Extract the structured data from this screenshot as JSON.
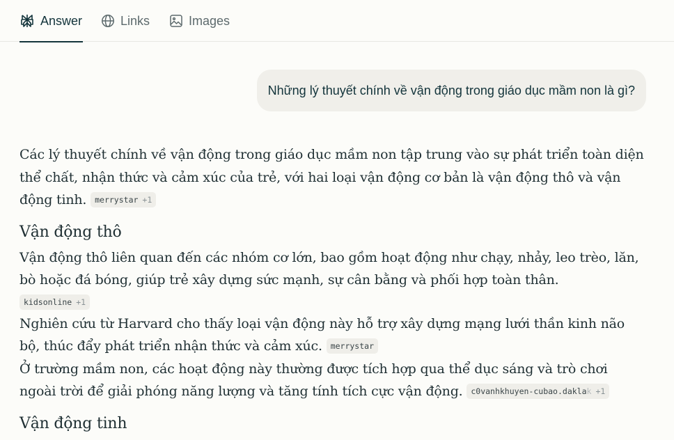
{
  "tabs": [
    {
      "label": "Answer",
      "icon": "perplexity-logo-icon",
      "active": true
    },
    {
      "label": "Links",
      "icon": "globe-icon",
      "active": false
    },
    {
      "label": "Images",
      "icon": "image-icon",
      "active": false
    }
  ],
  "query": "Những lý thuyết chính về vận động trong giáo dục mầm non là gì?",
  "answer": {
    "intro": {
      "text": "Các lý thuyết chính về vận động trong giáo dục mầm non tập trung vào sự phát triển toàn diện thể chất, nhận thức và cảm xúc của trẻ, với hai loại vận động cơ bản là vận động thô và vận động tinh. ",
      "citation": {
        "source": "merrystar",
        "more": "+1"
      }
    },
    "section1": {
      "heading": "Vận động thô",
      "p1": {
        "text": "Vận động thô liên quan đến các nhóm cơ lớn, bao gồm hoạt động như chạy, nhảy, leo trèo, lăn, bò hoặc đá bóng, giúp trẻ xây dựng sức mạnh, sự cân bằng và phối hợp toàn thân.",
        "citation": {
          "source": "kidsonline",
          "more": "+1"
        }
      },
      "p2": {
        "text": "Nghiên cứu từ Harvard cho thấy loại vận động này hỗ trợ xây dựng mạng lưới thần kinh não bộ, thúc đẩy phát triển nhận thức và cảm xúc. ",
        "citation": {
          "source": "merrystar"
        }
      },
      "p3": {
        "text": "Ở trường mầm non, các hoạt động này thường được tích hợp qua thể dục sáng và trò chơi ngoài trời để giải phóng năng lượng và tăng tính tích cực vận động. ",
        "citation": {
          "source": "c0vanhkhuyen-cubao.dakla",
          "source_faded": "k",
          "more": "+1"
        }
      }
    },
    "section2": {
      "heading": "Vận động tinh"
    }
  },
  "colors": {
    "background": "#fcfcf9",
    "text": "#13343b",
    "muted": "#5d6a6d",
    "bubble": "#f0efea",
    "citation_bg": "#efeee9"
  }
}
